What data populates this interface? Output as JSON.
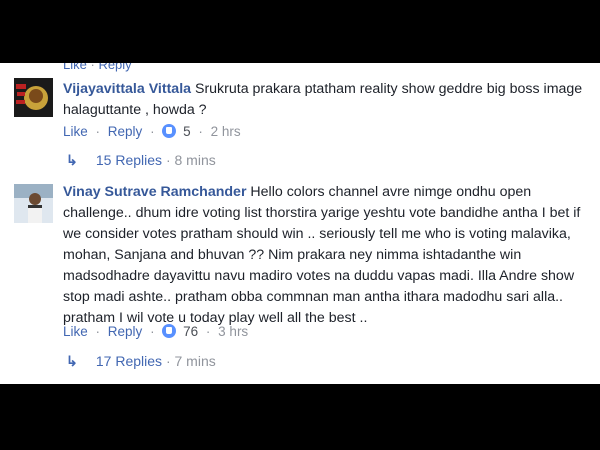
{
  "cutoff_row": {
    "like": "Like",
    "reply": "Reply"
  },
  "comments": [
    {
      "author": "Vijayavittala Vittala",
      "text": "Srukruta prakara ptatham reality show geddre big boss image halaguttante , howda ?",
      "like_label": "Like",
      "reply_label": "Reply",
      "reaction_count": "5",
      "time": "2 hrs",
      "replies_label": "15 Replies",
      "replies_time": "8 mins",
      "avatar_icon": "profile-avatar"
    },
    {
      "author": "Vinay Sutrave Ramchander",
      "text": "Hello colors channel avre nimge ondhu open challenge.. dhum idre voting list thorstira yarige yeshtu vote bandidhe antha I bet if we consider votes pratham should win .. seriously tell me who is voting malavika, mohan, Sanjana and bhuvan ?? Nim prakara ney nimma ishtadanthe win madsodhadre dayavittu navu madiro votes na duddu vapas madi. Illa Andre show stop madi ashte.. pratham obba commnan man antha ithara madodhu sari alla.. pratham I wil vote u today play well all the best ..",
      "like_label": "Like",
      "reply_label": "Reply",
      "reaction_count": "76",
      "time": "3 hrs",
      "replies_label": "17 Replies",
      "replies_time": "7 mins",
      "avatar_icon": "profile-avatar"
    }
  ],
  "colors": {
    "link": "#4267b2",
    "author": "#365899",
    "meta": "#90949c",
    "reaction": "#5890ff"
  }
}
